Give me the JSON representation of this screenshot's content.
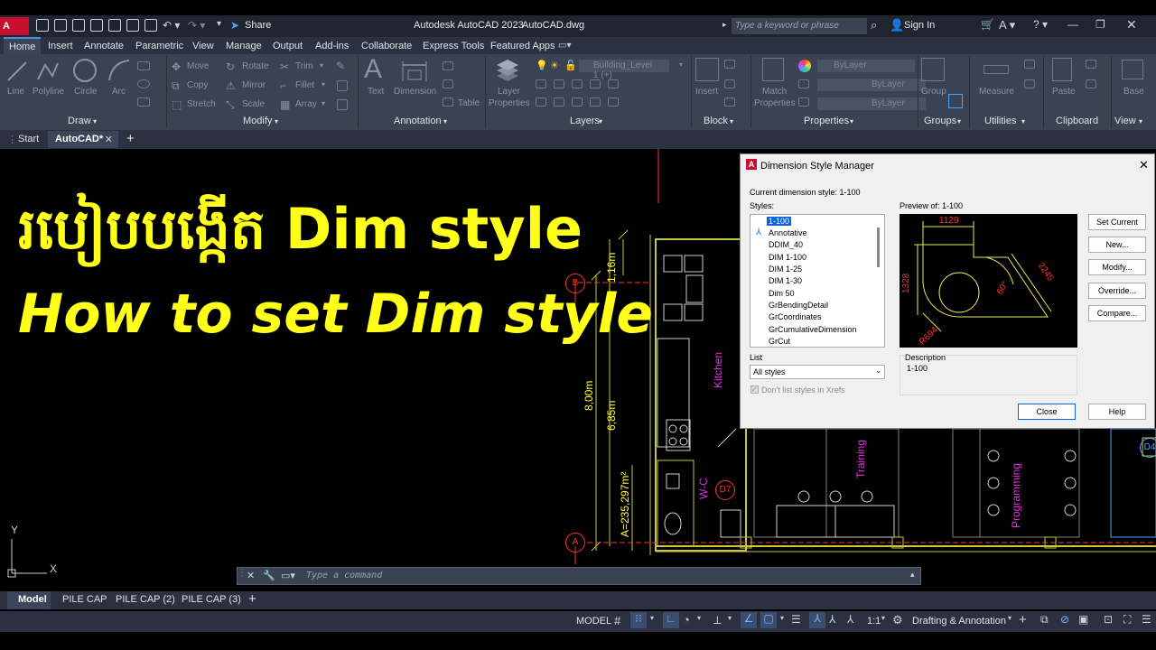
{
  "app": {
    "title": "Autodesk AutoCAD 2023",
    "file": "AutoCAD.dwg",
    "logo": "A CAD",
    "share_label": "Share",
    "search_placeholder": "Type a keyword or phrase",
    "sign_in": "Sign In"
  },
  "ribbon_tabs": [
    "Home",
    "Insert",
    "Annotate",
    "Parametric",
    "View",
    "Manage",
    "Output",
    "Add-ins",
    "Collaborate",
    "Express Tools",
    "Featured Apps"
  ],
  "ribbon": {
    "draw": {
      "title": "Draw",
      "tools": [
        "Line",
        "Polyline",
        "Circle",
        "Arc"
      ]
    },
    "modify": {
      "title": "Modify",
      "tools": [
        "Move",
        "Rotate",
        "Trim",
        "Copy",
        "Mirror",
        "Fillet",
        "Stretch",
        "Scale",
        "Array"
      ]
    },
    "annotation": {
      "title": "Annotation",
      "tools": [
        "Text",
        "Dimension",
        "Table"
      ]
    },
    "layers": {
      "title": "Layers",
      "tools": [
        "Layer Properties"
      ],
      "current_layer": "Building_Level 1 (+)"
    },
    "block": {
      "title": "Block",
      "tools": [
        "Insert"
      ]
    },
    "properties": {
      "title": "Properties",
      "tools": [
        "Match Properties"
      ],
      "color": "ByLayer",
      "linetype": "ByLayer",
      "lineweight": "ByLayer"
    },
    "groups": {
      "title": "Groups",
      "tools": [
        "Group"
      ]
    },
    "utilities": {
      "title": "Utilities",
      "tools": [
        "Measure"
      ]
    },
    "clipboard": {
      "title": "Clipboard",
      "tools": [
        "Paste"
      ]
    },
    "view": {
      "title": "View",
      "tools": [
        "Base"
      ]
    }
  },
  "doc_tabs": [
    "Start",
    "AutoCAD*"
  ],
  "overlay": {
    "khmer_title": "របៀបបង្កើត Dim style",
    "english_title": "How to set Dim style"
  },
  "drawing": {
    "dims_yellow": [
      "1,16m",
      "8,00m",
      "6,85m",
      "A=235,297m²"
    ],
    "rooms": [
      "Kitchen",
      "W-C",
      "Training",
      "Programming"
    ],
    "bubbles": [
      "B",
      "A",
      "D7",
      "D4"
    ]
  },
  "dialog": {
    "title": "Dimension Style Manager",
    "current_style_label": "Current dimension style: 1-100",
    "styles_label": "Styles:",
    "styles": [
      "1-100",
      "Annotative",
      "DDIM_40",
      "DIM 1-100",
      "DIM 1-25",
      "DIM 1-30",
      "Dim 50",
      "GrBendingDetail",
      "GrCoordinates",
      "GrCumulativeDimension",
      "GrCut"
    ],
    "selected_style": "1-100",
    "preview_label": "Preview of: 1-100",
    "preview_dims": [
      "1129",
      "1328",
      "2245",
      "60°",
      "R694"
    ],
    "list_label": "List",
    "list_value": "All styles",
    "xrefs_label": "Don't list styles in Xrefs",
    "description_label": "Description",
    "description_value": "1-100",
    "buttons": [
      "Set Current",
      "New...",
      "Modify...",
      "Override...",
      "Compare..."
    ],
    "close_label": "Close",
    "help_label": "Help"
  },
  "command_placeholder": "Type a command",
  "layout_tabs": [
    "Model",
    "PILE CAP",
    "PILE CAP (2)",
    "PILE CAP (3)"
  ],
  "status": {
    "model": "MODEL",
    "scale": "1:1",
    "workspace": "Drafting & Annotation"
  },
  "ucs": {
    "x": "X",
    "y": "Y"
  },
  "colors": {
    "accent": "#4a90e2",
    "yellow_text": "#ffff1a",
    "magenta": "#e633e6",
    "ribbon_bg": "#3b4252"
  }
}
